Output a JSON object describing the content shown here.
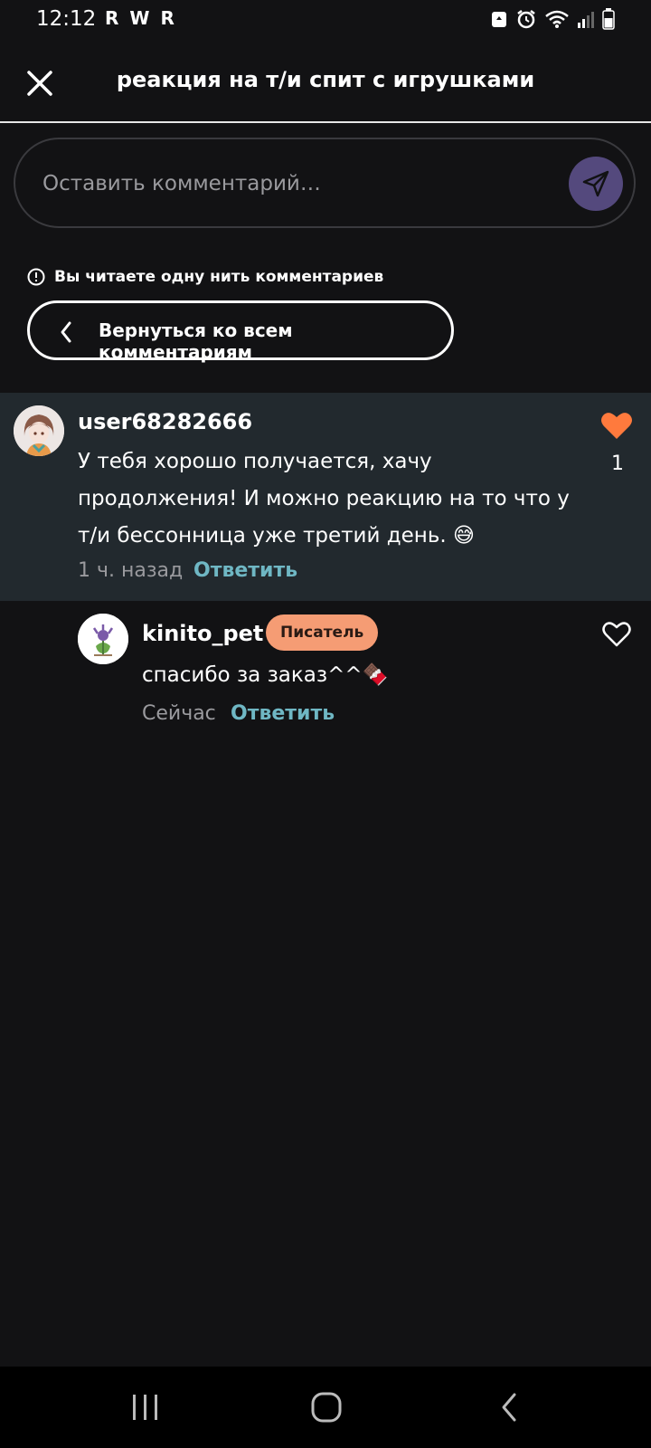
{
  "status_bar": {
    "time": "12:12",
    "app_icons": [
      "R",
      "W",
      "R"
    ]
  },
  "header": {
    "title": "реакция на т/и спит с игрушками"
  },
  "comment_input": {
    "placeholder": "Оставить комментарий…"
  },
  "thread": {
    "notice": "Вы читаете одну нить комментариев",
    "back_label": "Вернуться ко всем комментариям"
  },
  "comments": [
    {
      "username": "user68282666",
      "text": "У тебя хорошо получается, хачу продолжения!  И можно реакцию на то что у т/и бессонница уже третий день. 😅",
      "time": "1 ч. назад",
      "reply_label": "Ответить",
      "likes": "1",
      "liked": true
    },
    {
      "username": "kinito_pet",
      "badge": "Писатель",
      "text": "спасибо за заказ^^🍫",
      "time": "Сейчас",
      "reply_label": "Ответить",
      "liked": false
    }
  ],
  "colors": {
    "background": "#121214",
    "highlight": "#22292e",
    "accent_reply": "#6fb7c4",
    "heart": "#ff7a3d",
    "badge": "#f59c74",
    "send_button": "#54497d"
  },
  "icons": {
    "close": "close-icon",
    "send": "send-icon",
    "info": "info-icon",
    "back": "chevron-left-icon",
    "like": "heart-icon",
    "nav_recents": "recents-icon",
    "nav_home": "home-icon",
    "nav_back": "back-icon"
  }
}
